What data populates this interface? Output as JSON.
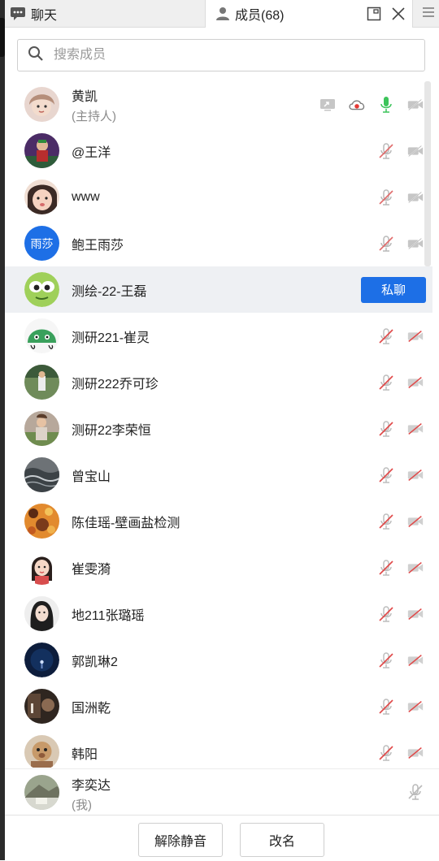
{
  "tabs": {
    "chat_label": "聊天",
    "members_label": "成员(68)"
  },
  "search": {
    "placeholder": "搜索成员"
  },
  "members": [
    {
      "name": "黄凯",
      "sub": "(主持人)",
      "avatar": "photo-girl",
      "icons": [
        "share-screen-icon",
        "cloud-record-icon",
        "mic-active-icon",
        "camera-off-icon"
      ]
    },
    {
      "name": "@王洋",
      "avatar": "photo-figure",
      "icons": [
        "mic-muted-icon",
        "camera-off-icon"
      ]
    },
    {
      "name": "www",
      "avatar": "photo-child",
      "icons": [
        "mic-muted-icon",
        "camera-off-icon"
      ]
    },
    {
      "name": "鲍王雨莎",
      "avatar": "text",
      "avatar_text": "雨莎",
      "icons": [
        "mic-muted-icon",
        "camera-off-icon"
      ]
    },
    {
      "name": "测绘-22-王磊",
      "avatar": "cartoon-green",
      "highlight": true,
      "action": "私聊"
    },
    {
      "name": "测研221-崔灵",
      "avatar": "cartoon-ghost",
      "icons": [
        "mic-muted-red-icon",
        "camera-off-red-icon"
      ]
    },
    {
      "name": "测研222乔可珍",
      "avatar": "photo-field",
      "icons": [
        "mic-muted-red-icon",
        "camera-off-red-icon"
      ]
    },
    {
      "name": "测研22李荣恒",
      "avatar": "photo-person",
      "icons": [
        "mic-muted-red-icon",
        "camera-off-red-icon"
      ]
    },
    {
      "name": "曾宝山",
      "avatar": "photo-sea",
      "icons": [
        "mic-muted-red-icon",
        "camera-off-red-icon"
      ]
    },
    {
      "name": "陈佳瑶-壁画盐检测",
      "avatar": "photo-pattern",
      "icons": [
        "mic-muted-red-icon",
        "camera-off-red-icon"
      ]
    },
    {
      "name": "崔雯漪",
      "avatar": "cartoon-girl",
      "icons": [
        "mic-muted-red-icon",
        "camera-off-red-icon"
      ]
    },
    {
      "name": "地211张璐瑶",
      "avatar": "photo-dark",
      "icons": [
        "mic-muted-red-icon",
        "camera-off-red-icon"
      ]
    },
    {
      "name": "郭凯琳2",
      "avatar": "photo-night",
      "icons": [
        "mic-muted-red-icon",
        "camera-off-red-icon"
      ]
    },
    {
      "name": "国洲乾",
      "avatar": "photo-brown",
      "icons": [
        "mic-muted-red-icon",
        "camera-off-red-icon"
      ]
    },
    {
      "name": "韩阳",
      "avatar": "photo-toy",
      "icons": [
        "mic-muted-red-icon",
        "camera-off-red-icon"
      ]
    }
  ],
  "me": {
    "name": "李奕达",
    "sub": "(我)"
  },
  "buttons": {
    "unmute": "解除静音",
    "rename": "改名"
  },
  "colors": {
    "accent": "#1d6fe6",
    "mic_active": "#3cc45a",
    "muted_red": "#e04a4a",
    "record_red": "#e53935"
  }
}
